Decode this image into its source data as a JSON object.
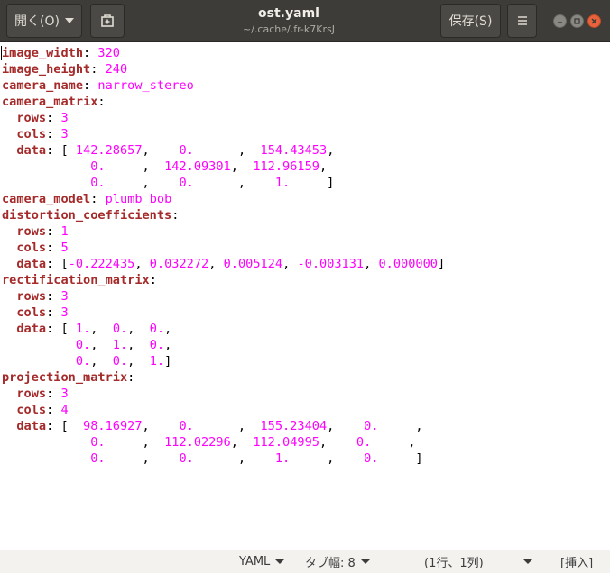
{
  "header": {
    "open_label": "開く(O)",
    "title": "ost.yaml",
    "subtitle": "~/.cache/.fr-k7KrsJ",
    "save_label": "保存(S)"
  },
  "editor": {
    "lines": [
      [
        {
          "k": "image_width"
        },
        {
          "t": ": "
        },
        {
          "v": "320"
        }
      ],
      [
        {
          "k": "image_height"
        },
        {
          "t": ": "
        },
        {
          "v": "240"
        }
      ],
      [
        {
          "k": "camera_name"
        },
        {
          "t": ": "
        },
        {
          "v": "narrow_stereo"
        }
      ],
      [
        {
          "k": "camera_matrix"
        },
        {
          "t": ":"
        }
      ],
      [
        {
          "t": "  "
        },
        {
          "k": "rows"
        },
        {
          "t": ": "
        },
        {
          "v": "3"
        }
      ],
      [
        {
          "t": "  "
        },
        {
          "k": "cols"
        },
        {
          "t": ": "
        },
        {
          "v": "3"
        }
      ],
      [
        {
          "t": "  "
        },
        {
          "k": "data"
        },
        {
          "t": ": [ "
        },
        {
          "v": "142.28657"
        },
        {
          "t": ",    "
        },
        {
          "v": "0."
        },
        {
          "t": "      ,  "
        },
        {
          "v": "154.43453"
        },
        {
          "t": ","
        }
      ],
      [
        {
          "t": "            "
        },
        {
          "v": "0."
        },
        {
          "t": "     ,  "
        },
        {
          "v": "142.09301"
        },
        {
          "t": ",  "
        },
        {
          "v": "112.96159"
        },
        {
          "t": ","
        }
      ],
      [
        {
          "t": "            "
        },
        {
          "v": "0."
        },
        {
          "t": "     ,    "
        },
        {
          "v": "0."
        },
        {
          "t": "      ,    "
        },
        {
          "v": "1."
        },
        {
          "t": "     ]"
        }
      ],
      [
        {
          "k": "camera_model"
        },
        {
          "t": ": "
        },
        {
          "v": "plumb_bob"
        }
      ],
      [
        {
          "k": "distortion_coefficients"
        },
        {
          "t": ":"
        }
      ],
      [
        {
          "t": "  "
        },
        {
          "k": "rows"
        },
        {
          "t": ": "
        },
        {
          "v": "1"
        }
      ],
      [
        {
          "t": "  "
        },
        {
          "k": "cols"
        },
        {
          "t": ": "
        },
        {
          "v": "5"
        }
      ],
      [
        {
          "t": "  "
        },
        {
          "k": "data"
        },
        {
          "t": ": ["
        },
        {
          "v": "-0.222435"
        },
        {
          "t": ", "
        },
        {
          "v": "0.032272"
        },
        {
          "t": ", "
        },
        {
          "v": "0.005124"
        },
        {
          "t": ", "
        },
        {
          "v": "-0.003131"
        },
        {
          "t": ", "
        },
        {
          "v": "0.000000"
        },
        {
          "t": "]"
        }
      ],
      [
        {
          "k": "rectification_matrix"
        },
        {
          "t": ":"
        }
      ],
      [
        {
          "t": "  "
        },
        {
          "k": "rows"
        },
        {
          "t": ": "
        },
        {
          "v": "3"
        }
      ],
      [
        {
          "t": "  "
        },
        {
          "k": "cols"
        },
        {
          "t": ": "
        },
        {
          "v": "3"
        }
      ],
      [
        {
          "t": "  "
        },
        {
          "k": "data"
        },
        {
          "t": ": [ "
        },
        {
          "v": "1."
        },
        {
          "t": ",  "
        },
        {
          "v": "0."
        },
        {
          "t": ",  "
        },
        {
          "v": "0."
        },
        {
          "t": ","
        }
      ],
      [
        {
          "t": "          "
        },
        {
          "v": "0."
        },
        {
          "t": ",  "
        },
        {
          "v": "1."
        },
        {
          "t": ",  "
        },
        {
          "v": "0."
        },
        {
          "t": ","
        }
      ],
      [
        {
          "t": "          "
        },
        {
          "v": "0."
        },
        {
          "t": ",  "
        },
        {
          "v": "0."
        },
        {
          "t": ",  "
        },
        {
          "v": "1."
        },
        {
          "t": "]"
        }
      ],
      [
        {
          "k": "projection_matrix"
        },
        {
          "t": ":"
        }
      ],
      [
        {
          "t": "  "
        },
        {
          "k": "rows"
        },
        {
          "t": ": "
        },
        {
          "v": "3"
        }
      ],
      [
        {
          "t": "  "
        },
        {
          "k": "cols"
        },
        {
          "t": ": "
        },
        {
          "v": "4"
        }
      ],
      [
        {
          "t": "  "
        },
        {
          "k": "data"
        },
        {
          "t": ": [  "
        },
        {
          "v": "98.16927"
        },
        {
          "t": ",    "
        },
        {
          "v": "0."
        },
        {
          "t": "      ,  "
        },
        {
          "v": "155.23404"
        },
        {
          "t": ",    "
        },
        {
          "v": "0."
        },
        {
          "t": "     ,"
        }
      ],
      [
        {
          "t": "            "
        },
        {
          "v": "0."
        },
        {
          "t": "     ,  "
        },
        {
          "v": "112.02296"
        },
        {
          "t": ",  "
        },
        {
          "v": "112.04995"
        },
        {
          "t": ",    "
        },
        {
          "v": "0."
        },
        {
          "t": "     ,"
        }
      ],
      [
        {
          "t": "            "
        },
        {
          "v": "0."
        },
        {
          "t": "     ,    "
        },
        {
          "v": "0."
        },
        {
          "t": "      ,    "
        },
        {
          "v": "1."
        },
        {
          "t": "     ,    "
        },
        {
          "v": "0."
        },
        {
          "t": "     ]"
        }
      ]
    ]
  },
  "statusbar": {
    "language": "YAML",
    "tab_width": "タブ幅: 8",
    "position": "(1行、1列)",
    "mode": "[挿入]"
  },
  "icons": {
    "new_tab": "new-tab-icon",
    "menu": "hamburger-menu-icon",
    "minimize": "minimize-icon",
    "maximize": "maximize-icon",
    "close": "close-icon"
  }
}
